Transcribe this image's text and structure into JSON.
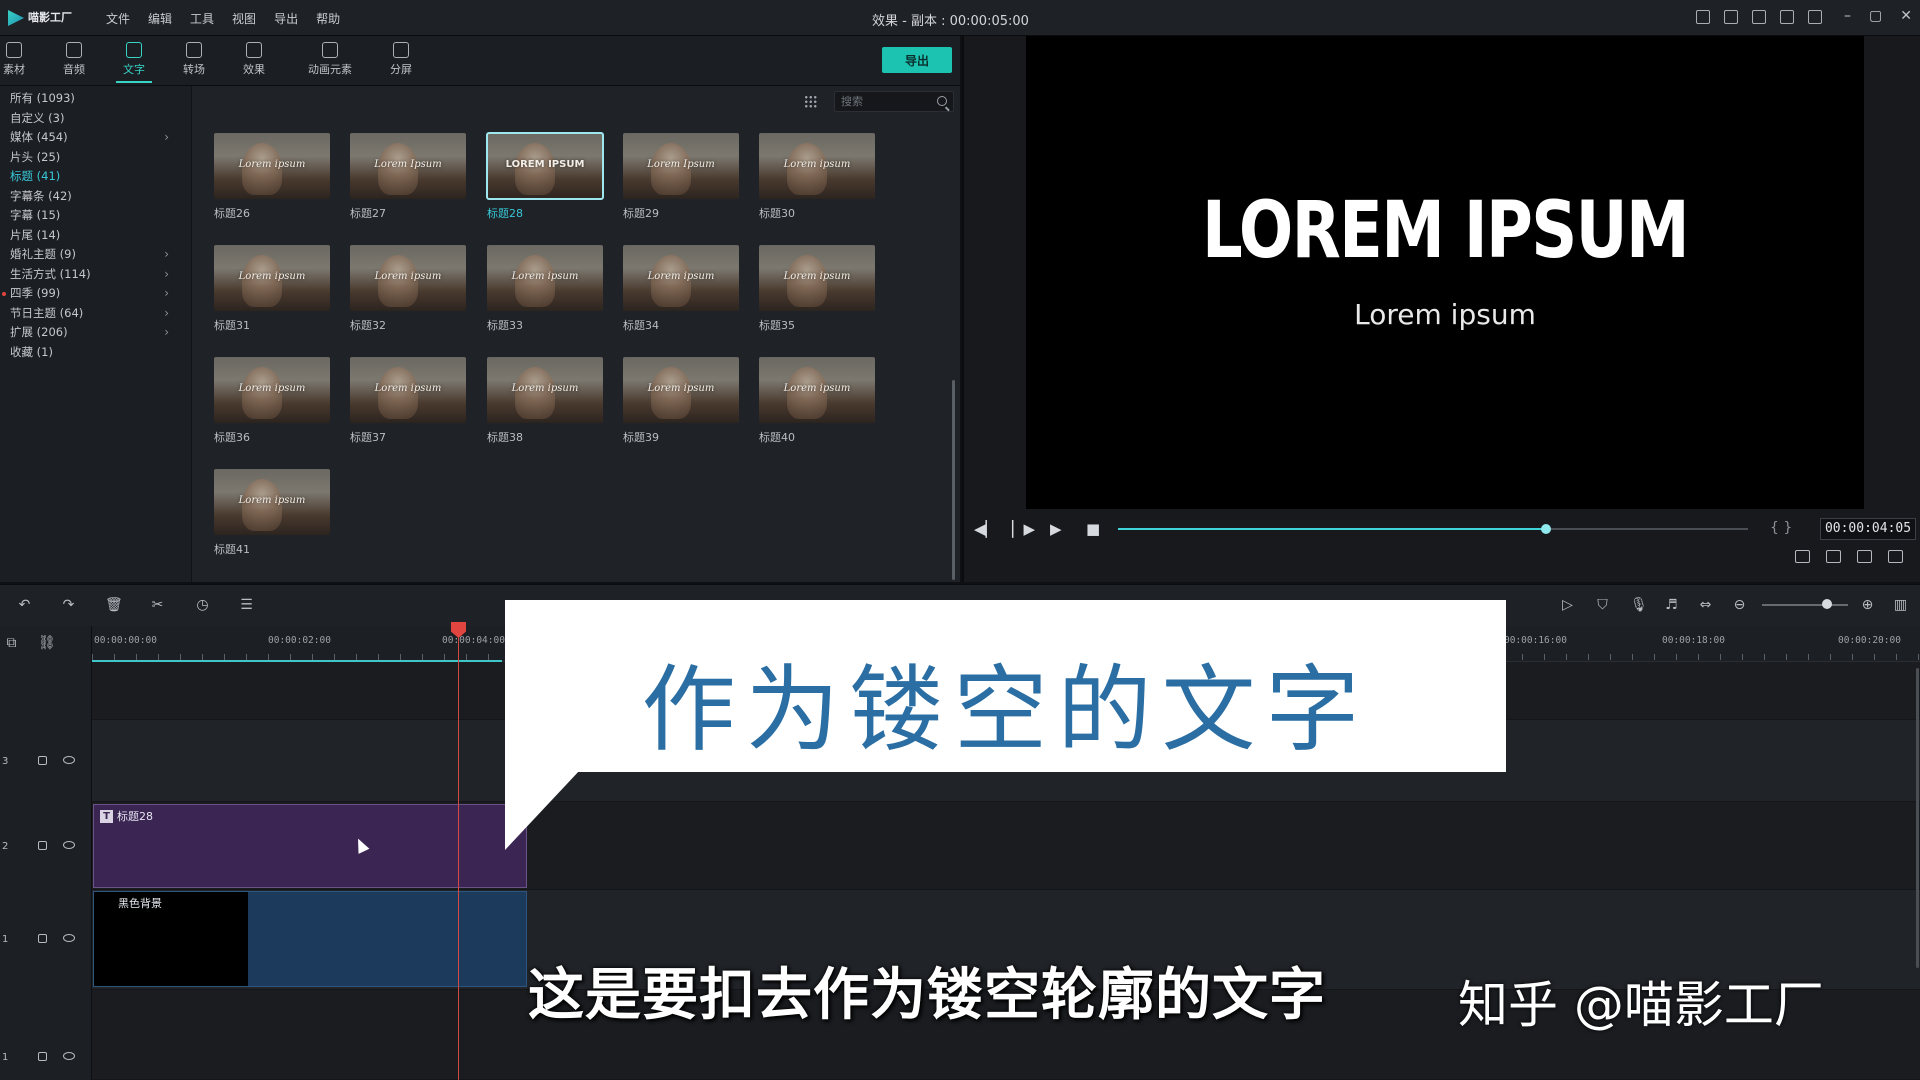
{
  "app": {
    "logo_text": "喵影工厂",
    "menu": [
      "文件",
      "编辑",
      "工具",
      "视图",
      "导出",
      "帮助"
    ],
    "doc_title": "效果 - 副本 : 00:00:05:00",
    "window_controls": [
      "–",
      "▢",
      "✕"
    ]
  },
  "library": {
    "tabs": [
      {
        "label": "素材",
        "icon": "folder-icon"
      },
      {
        "label": "音频",
        "icon": "music-icon"
      },
      {
        "label": "文字",
        "icon": "text-icon",
        "active": true
      },
      {
        "label": "转场",
        "icon": "transition-icon"
      },
      {
        "label": "效果",
        "icon": "effect-icon"
      },
      {
        "label": "动画元素",
        "icon": "image-icon"
      },
      {
        "label": "分屏",
        "icon": "split-screen-icon"
      }
    ],
    "export_label": "导出",
    "search_placeholder": "搜索",
    "categories": [
      {
        "label": "所有 (1093)",
        "chevron": false
      },
      {
        "label": "自定义 (3)",
        "chevron": false
      },
      {
        "label": "媒体 (454)",
        "chevron": true
      },
      {
        "label": "片头 (25)",
        "chevron": false
      },
      {
        "label": "标题 (41)",
        "chevron": false,
        "active": true
      },
      {
        "label": "字幕条 (42)",
        "chevron": false
      },
      {
        "label": "字幕 (15)",
        "chevron": false
      },
      {
        "label": "片尾 (14)",
        "chevron": false
      },
      {
        "label": "婚礼主题 (9)",
        "chevron": true
      },
      {
        "label": "生活方式 (114)",
        "chevron": true
      },
      {
        "label": "四季 (99)",
        "chevron": true,
        "dot": true
      },
      {
        "label": "节日主题 (64)",
        "chevron": true
      },
      {
        "label": "扩展 (206)",
        "chevron": true
      },
      {
        "label": "收藏 (1)",
        "chevron": false
      }
    ],
    "thumbnails": [
      {
        "label": "标题26",
        "text": "Lorem ipsum"
      },
      {
        "label": "标题27",
        "text": "Lorem Ipsum"
      },
      {
        "label": "标题28",
        "text": "LOREM IPSUM",
        "selected": true
      },
      {
        "label": "标题29",
        "text": "Lorem Ipsum"
      },
      {
        "label": "标题30",
        "text": "Lorem ipsum"
      },
      {
        "label": "标题31",
        "text": "Lorem ipsum"
      },
      {
        "label": "标题32",
        "text": "Lorem ipsum"
      },
      {
        "label": "标题33",
        "text": "Lorem ipsum"
      },
      {
        "label": "标题34",
        "text": "Lorem ipsum"
      },
      {
        "label": "标题35",
        "text": "Lorem ipsum"
      },
      {
        "label": "标题36",
        "text": "Lorem ipsum"
      },
      {
        "label": "标题37",
        "text": "Lorem ipsum"
      },
      {
        "label": "标题38",
        "text": "Lorem ipsum"
      },
      {
        "label": "标题39",
        "text": "Lorem ipsum"
      },
      {
        "label": "标题40",
        "text": "Lorem ipsum"
      },
      {
        "label": "标题41",
        "text": "Lorem ipsum"
      }
    ]
  },
  "preview": {
    "title": "LOREM IPSUM",
    "subtitle": "Lorem ipsum",
    "brackets": "{ }",
    "timecode": "00:00:04:05",
    "progress": 0.68
  },
  "timeline": {
    "ruler": [
      "00:00:00:00",
      "00:00:02:00",
      "00:00:04:00",
      "00:00:16:00",
      "00:00:18:00",
      "00:00:20:00"
    ],
    "tracks": [
      {
        "num": "3"
      },
      {
        "num": "2"
      },
      {
        "num": "1"
      },
      {
        "num": "1",
        "audio": true
      }
    ],
    "clip_title_label": "标题28",
    "clip_title_badge": "T",
    "clip_bg_label": "黑色背景",
    "zoom_level": 0.7
  },
  "overlay": {
    "callout": "作为镂空的文字",
    "subtitle": "这是要扣去作为镂空轮廓的文字",
    "watermark": "知乎 @喵影工厂"
  },
  "colors": {
    "accent": "#37d3c5",
    "export": "#1cc3b1",
    "callout_text": "#2a6ea3",
    "title_clip": "#3a2553",
    "bg_clip": "#1b3a5c",
    "playhead": "#e0453f"
  }
}
